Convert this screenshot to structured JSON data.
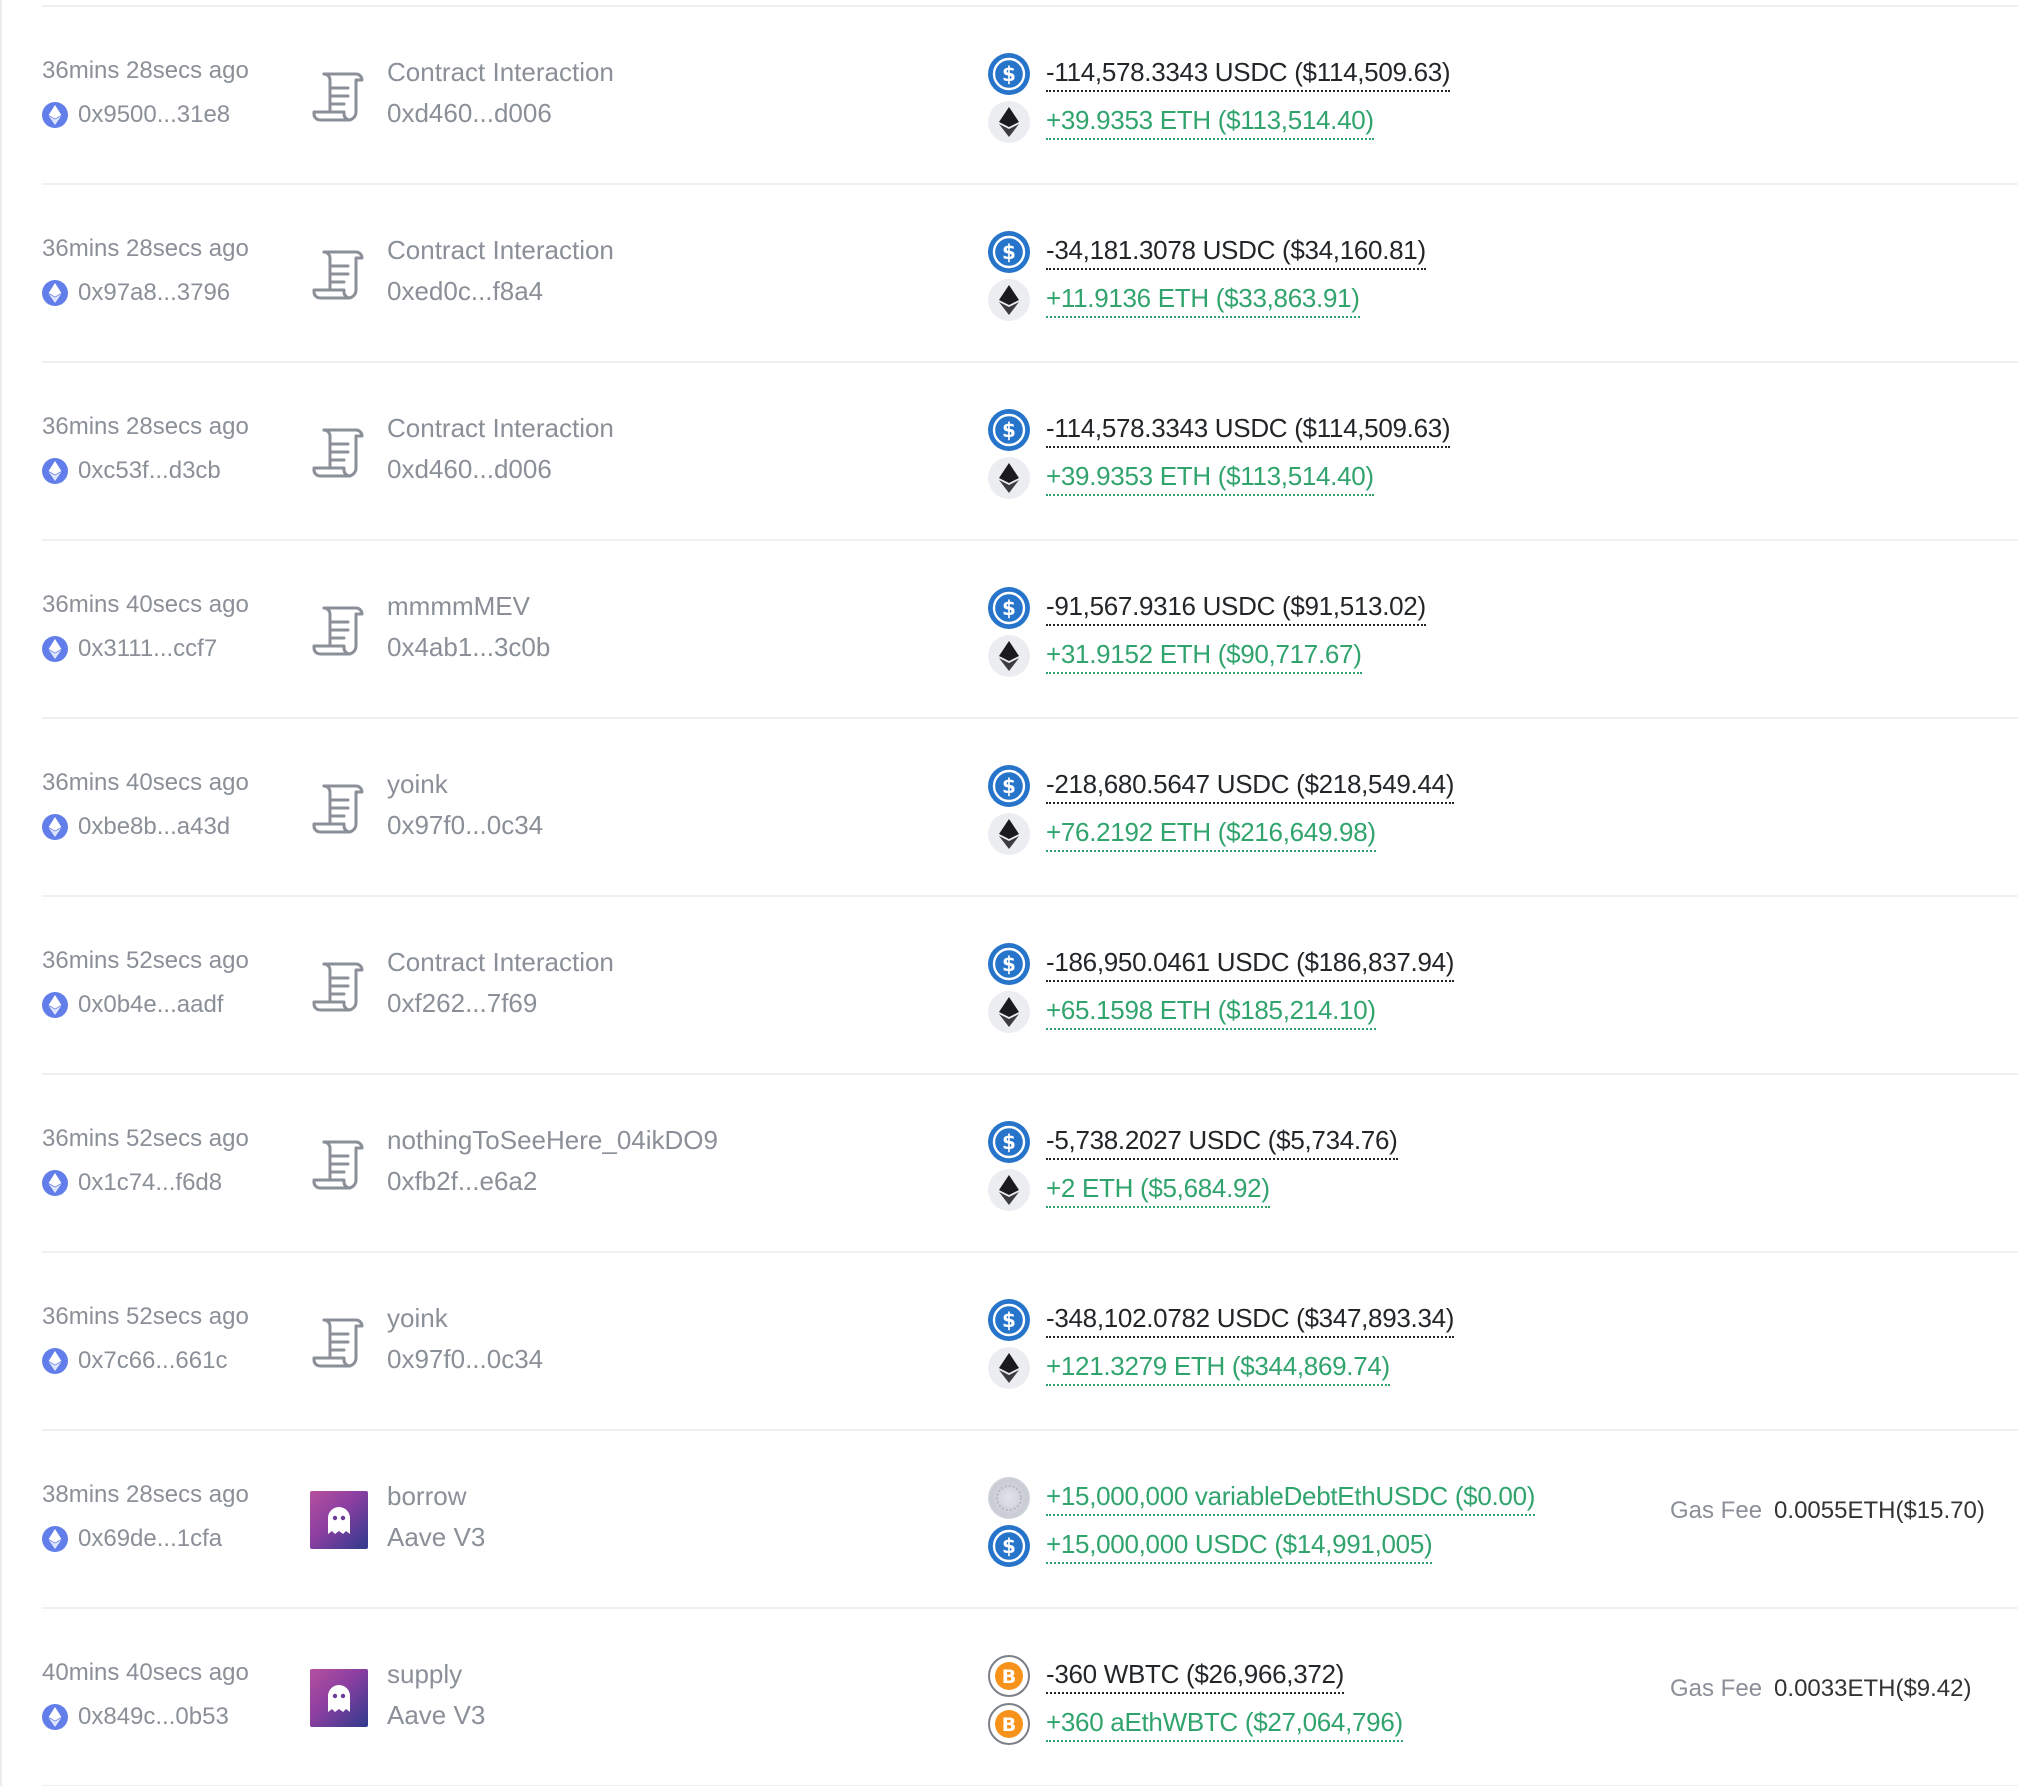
{
  "rows": [
    {
      "time": "36mins 28secs ago",
      "hash": "0x9500...31e8",
      "method": "Contract Interaction",
      "address": "0xd460...d006",
      "icon_type": "contract",
      "line1": {
        "token": "usdc",
        "text": "-114,578.3343 USDC ($114,509.63)",
        "sign": "neg"
      },
      "line2": {
        "token": "eth",
        "text": "+39.9353 ETH ($113,514.40)",
        "sign": "pos"
      },
      "gas_label": "",
      "gas_value": ""
    },
    {
      "time": "36mins 28secs ago",
      "hash": "0x97a8...3796",
      "method": "Contract Interaction",
      "address": "0xed0c...f8a4",
      "icon_type": "contract",
      "line1": {
        "token": "usdc",
        "text": "-34,181.3078 USDC ($34,160.81)",
        "sign": "neg"
      },
      "line2": {
        "token": "eth",
        "text": "+11.9136 ETH ($33,863.91)",
        "sign": "pos"
      },
      "gas_label": "",
      "gas_value": ""
    },
    {
      "time": "36mins 28secs ago",
      "hash": "0xc53f...d3cb",
      "method": "Contract Interaction",
      "address": "0xd460...d006",
      "icon_type": "contract",
      "line1": {
        "token": "usdc",
        "text": "-114,578.3343 USDC ($114,509.63)",
        "sign": "neg"
      },
      "line2": {
        "token": "eth",
        "text": "+39.9353 ETH ($113,514.40)",
        "sign": "pos"
      },
      "gas_label": "",
      "gas_value": ""
    },
    {
      "time": "36mins 40secs ago",
      "hash": "0x3111...ccf7",
      "method": "mmmmMEV",
      "address": "0x4ab1...3c0b",
      "icon_type": "contract",
      "line1": {
        "token": "usdc",
        "text": "-91,567.9316 USDC ($91,513.02)",
        "sign": "neg"
      },
      "line2": {
        "token": "eth",
        "text": "+31.9152 ETH ($90,717.67)",
        "sign": "pos"
      },
      "gas_label": "",
      "gas_value": ""
    },
    {
      "time": "36mins 40secs ago",
      "hash": "0xbe8b...a43d",
      "method": "yoink",
      "address": "0x97f0...0c34",
      "icon_type": "contract",
      "line1": {
        "token": "usdc",
        "text": "-218,680.5647 USDC ($218,549.44)",
        "sign": "neg"
      },
      "line2": {
        "token": "eth",
        "text": "+76.2192 ETH ($216,649.98)",
        "sign": "pos"
      },
      "gas_label": "",
      "gas_value": ""
    },
    {
      "time": "36mins 52secs ago",
      "hash": "0x0b4e...aadf",
      "method": "Contract Interaction",
      "address": "0xf262...7f69",
      "icon_type": "contract",
      "line1": {
        "token": "usdc",
        "text": "-186,950.0461 USDC ($186,837.94)",
        "sign": "neg"
      },
      "line2": {
        "token": "eth",
        "text": "+65.1598 ETH ($185,214.10)",
        "sign": "pos"
      },
      "gas_label": "",
      "gas_value": ""
    },
    {
      "time": "36mins 52secs ago",
      "hash": "0x1c74...f6d8",
      "method": "nothingToSeeHere_04ikDO9",
      "address": "0xfb2f...e6a2",
      "icon_type": "contract",
      "line1": {
        "token": "usdc",
        "text": "-5,738.2027 USDC ($5,734.76)",
        "sign": "neg"
      },
      "line2": {
        "token": "eth",
        "text": "+2 ETH ($5,684.92)",
        "sign": "pos"
      },
      "gas_label": "",
      "gas_value": ""
    },
    {
      "time": "36mins 52secs ago",
      "hash": "0x7c66...661c",
      "method": "yoink",
      "address": "0x97f0...0c34",
      "icon_type": "contract",
      "line1": {
        "token": "usdc",
        "text": "-348,102.0782 USDC ($347,893.34)",
        "sign": "neg"
      },
      "line2": {
        "token": "eth",
        "text": "+121.3279 ETH ($344,869.74)",
        "sign": "pos"
      },
      "gas_label": "",
      "gas_value": ""
    },
    {
      "time": "38mins 28secs ago",
      "hash": "0x69de...1cfa",
      "method": "borrow",
      "address": "Aave V3",
      "icon_type": "aave",
      "line1": {
        "token": "debt",
        "text": "+15,000,000 variableDebtEthUSDC ($0.00)",
        "sign": "pos"
      },
      "line2": {
        "token": "usdc",
        "text": "+15,000,000 USDC ($14,991,005)",
        "sign": "pos"
      },
      "gas_label": "Gas Fee",
      "gas_value": "0.0055ETH($15.70)"
    },
    {
      "time": "40mins 40secs ago",
      "hash": "0x849c...0b53",
      "method": "supply",
      "address": "Aave V3",
      "icon_type": "aave",
      "line1": {
        "token": "btc",
        "text": "-360 WBTC ($26,966,372)",
        "sign": "neg"
      },
      "line2": {
        "token": "btc",
        "text": "+360 aEthWBTC ($27,064,796)",
        "sign": "pos"
      },
      "gas_label": "Gas Fee",
      "gas_value": "0.0033ETH($9.42)"
    }
  ],
  "colors": {
    "usdc": "#2775ca",
    "eth_badge": "#627eea",
    "positive": "#31a46e",
    "negative": "#222629",
    "muted": "#8a8f98"
  },
  "icons": {
    "contract": "scroll-contract-icon",
    "aave": "aave-ghost-icon",
    "usdc": "usdc-token-icon",
    "eth": "eth-token-icon",
    "btc": "btc-token-icon",
    "debt": "debt-token-icon",
    "chain": "ethereum-chain-icon"
  }
}
